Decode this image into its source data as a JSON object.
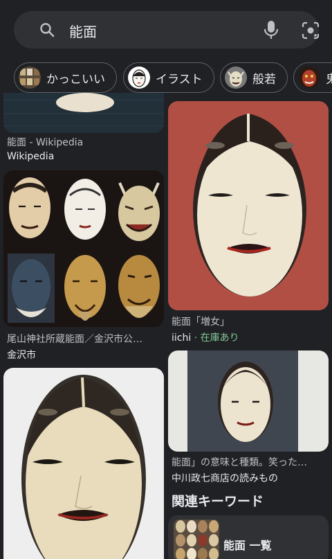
{
  "search": {
    "query": "能面",
    "search_icon": "search-icon",
    "mic_icon": "mic-icon",
    "lens_icon": "lens-icon"
  },
  "chips": [
    {
      "label": "かっこいい"
    },
    {
      "label": "イラスト"
    },
    {
      "label": "般若"
    },
    {
      "label": "鬼"
    }
  ],
  "results": [
    {
      "title": "能面 - Wikipedia",
      "source": "Wikipedia"
    },
    {
      "title": "能面「増女」",
      "source": "iichi",
      "badge": "在庫あり",
      "separator": " · "
    },
    {
      "title": "尾山神社所蔵能面／金沢市公…",
      "source": "金沢市"
    },
    {
      "title": "能面」の意味と種類。笑った…",
      "source": "中川政七商店の読みもの"
    },
    {
      "title": "",
      "source": ""
    }
  ],
  "related": {
    "heading": "関連キーワード",
    "items": [
      {
        "label": "能面 一覧"
      }
    ]
  },
  "colors": {
    "background": "#202124",
    "surface": "#303134",
    "in_stock": "#81c995"
  }
}
